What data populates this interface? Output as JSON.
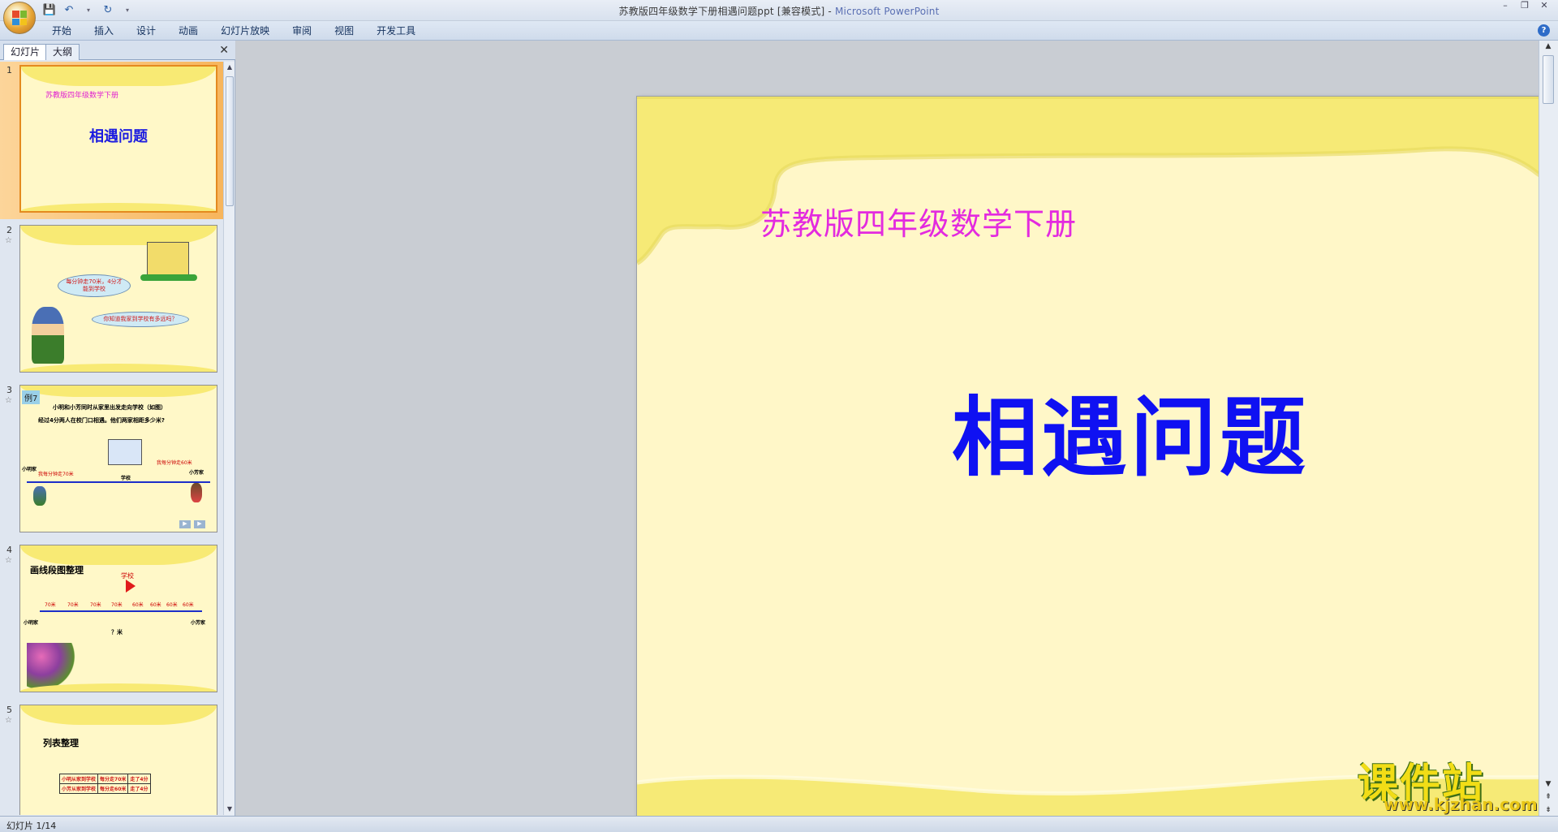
{
  "window": {
    "title": "苏教版四年级数学下册相遇问题ppt [兼容模式] - ",
    "app_name": "Microsoft PowerPoint",
    "minimize": "–",
    "restore": "❐",
    "close": "✕"
  },
  "ribbon": {
    "tabs": [
      "开始",
      "插入",
      "设计",
      "动画",
      "幻灯片放映",
      "审阅",
      "视图",
      "开发工具"
    ],
    "help": "?"
  },
  "panel": {
    "tab_slides": "幻灯片",
    "tab_outline": "大纲",
    "close": "✕"
  },
  "thumbnails": [
    {
      "num": "1",
      "sub": "苏教版四年级数学下册",
      "title": "相遇问题"
    },
    {
      "num": "2",
      "bubble1": "每分钟走70米，4分才能到学校",
      "bubble2": "你知道我家到学校有多远吗？"
    },
    {
      "num": "3",
      "label": "例7",
      "line1": "小明和小芳同时从家里出发走向学校（如图）",
      "line2": "经过4分两人在校门口相遇。他们两家相距多少米?",
      "left_home": "小明家",
      "right_home": "小芳家",
      "school": "学校",
      "speed_left": "我每分钟走70米",
      "speed_right": "我每分钟走60米"
    },
    {
      "num": "4",
      "heading": "画线段图整理",
      "school": "学校",
      "left": "小明家",
      "right": "小芳家",
      "unknown": "？米",
      "seg70": "70米",
      "seg60": "60米"
    },
    {
      "num": "5",
      "heading": "列表整理",
      "rows": [
        [
          "小明从家到学校",
          "每分走70米",
          "走了4分"
        ],
        [
          "小芳从家到学校",
          "每分走60米",
          "走了4分"
        ]
      ]
    }
  ],
  "slide": {
    "subtitle": "苏教版四年级数学下册",
    "title": "相遇问题"
  },
  "watermark": {
    "brand": "课件站",
    "url": "www.kjzhan.com"
  },
  "status": {
    "slide_counter": "幻灯片 1/14"
  }
}
